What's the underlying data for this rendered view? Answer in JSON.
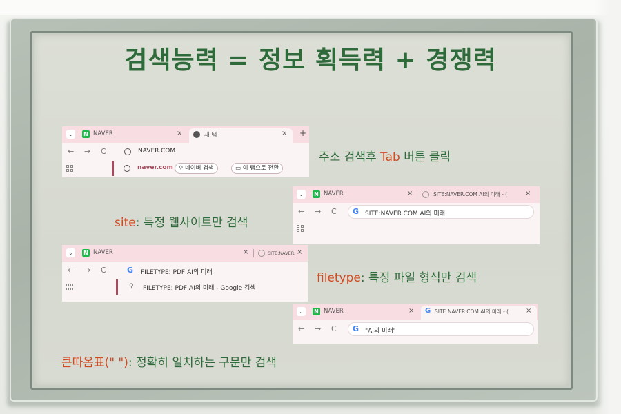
{
  "title": "검색능력 = 정보 획득력 + 경쟁력",
  "captions": {
    "tab_tip": {
      "pre": "주소 검색후 ",
      "hl": "Tab",
      "post": " 버튼 클릭"
    },
    "site_tip": {
      "hl": "site",
      "post": ": 특정 웹사이트만 검색"
    },
    "filetype_tip": {
      "hl": "filetype",
      "post": ": 특정 파일 형식만 검색"
    },
    "quote_tip": {
      "hl": "큰따옴표(\" \")",
      "post": ": 정확히 일치하는 구문만 검색"
    }
  },
  "browser1": {
    "tab1": "NAVER",
    "tab2": "새 탭",
    "new_tab": "+",
    "address": "NAVER.COM",
    "suggestion_site": "naver.com",
    "chip_search": "네이버 검색",
    "chip_switch": "이 탭으로 전환"
  },
  "browser2": {
    "tab1": "NAVER",
    "tab2": "SITE:NAVER.COM AI의 미래 - (",
    "address": "SITE:NAVER.COM AI의 미래"
  },
  "browser3": {
    "tab1": "NAVER",
    "tab2": "SITE:NAVER.COM AI의 미래 - (",
    "address_pre": "FILETYPE: PDF",
    "address_post": "AI의 미래",
    "suggestion": "FILETYPE: PDF AI의 미래 - Google 검색"
  },
  "browser4": {
    "tab1": "NAVER",
    "tab2": "SITE:NAVER.COM AI의 미래 - (",
    "address": "\"AI의 미래\""
  },
  "glyphs": {
    "chevron": "⌄",
    "close": "×",
    "back": "←",
    "forward": "→",
    "reload": "C",
    "search": "⚲",
    "google": "G",
    "naver": "N"
  },
  "colors": {
    "title": "#2f6b3a",
    "caption": "#2e6a3a",
    "highlight": "#d14b22",
    "tabbar": "#f8dde2",
    "naver_green": "#1fb94b"
  }
}
